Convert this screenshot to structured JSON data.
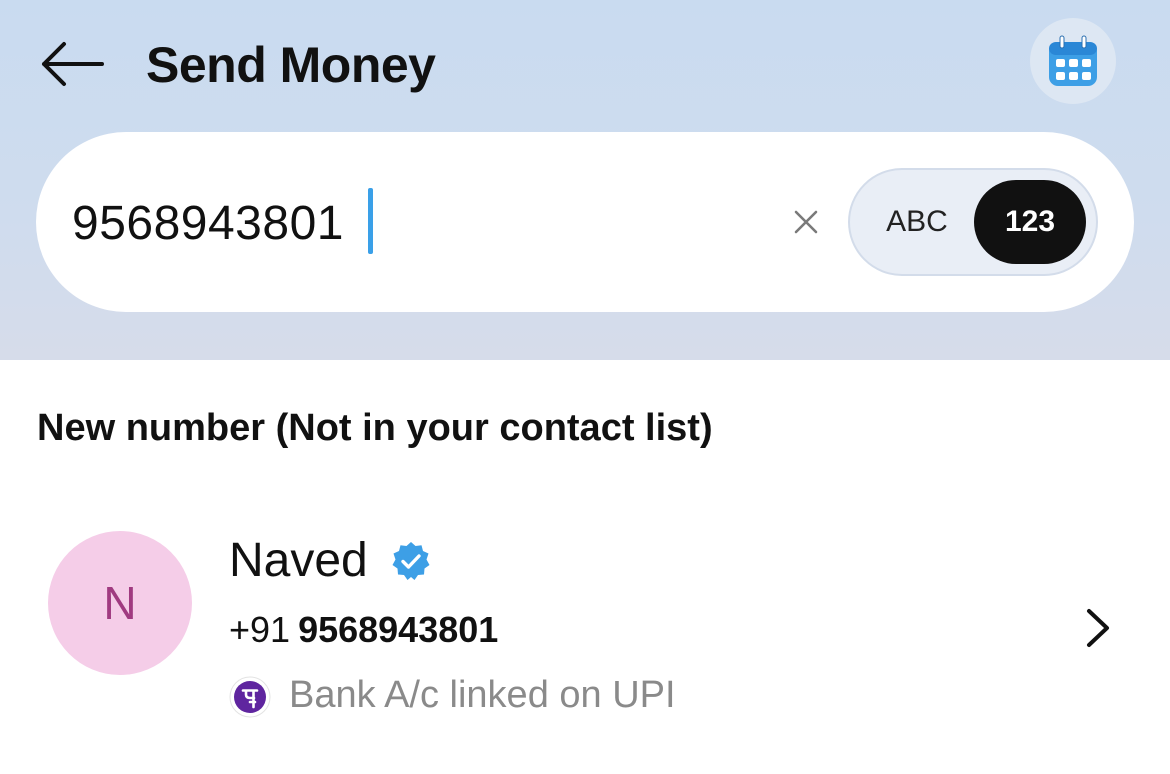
{
  "header": {
    "title": "Send Money",
    "back_icon": "arrow-left-icon",
    "calendar_icon": "calendar-icon"
  },
  "search": {
    "value": "9568943801",
    "clear_icon": "close-icon"
  },
  "input_mode": {
    "options": [
      "ABC",
      "123"
    ],
    "selected": "123"
  },
  "section": {
    "heading": "New number (Not in your contact list)"
  },
  "contact": {
    "avatar_initial": "N",
    "name": "Naved",
    "country_code": "+91",
    "phone": "9568943801",
    "upi_status": "Bank A/c linked on UPI",
    "verified_icon": "verified-badge-icon",
    "upi_icon": "phonepe-logo-icon",
    "chevron_icon": "chevron-right-icon"
  },
  "colors": {
    "header_bg": "#c9dbf0",
    "caret": "#3aa0e8",
    "avatar_bg": "#f5cde8",
    "avatar_text": "#a03a80",
    "verified": "#3d9fe6",
    "upi_logo": "#5f259f",
    "muted_text": "#8a8a8a"
  }
}
